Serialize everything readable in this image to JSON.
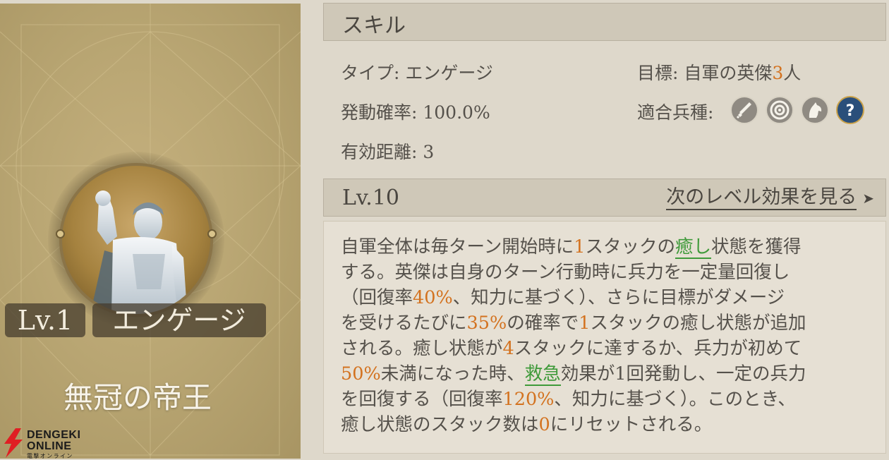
{
  "card": {
    "level": "Lv.1",
    "skill_type_badge": "エンゲージ",
    "skill_name": "無冠の帝王",
    "accent_color": "#b9a673"
  },
  "logo": {
    "line1": "DENGEKI",
    "line2": "ONLINE",
    "line3": "電撃オンライン"
  },
  "skill_section": {
    "title": "スキル",
    "type_label": "タイプ: エンゲージ",
    "trigger_rate_label": "発動確率: 100.0%",
    "range_label": "有効距離: 3",
    "target_prefix": "目標: 自軍の英傑",
    "target_count": "3",
    "target_suffix": "人",
    "troop_label": "適合兵種:",
    "troop_icons": [
      "sword-icon",
      "target-archery-icon",
      "horse-icon",
      "question-icon"
    ]
  },
  "level_section": {
    "level": "Lv.10",
    "next_link": "次のレベル効果を見る"
  },
  "description": {
    "l1": [
      "自軍全体は毎ターン開始時に",
      "1",
      "スタックの",
      "癒し",
      "状態を獲得"
    ],
    "l2": [
      "する。英傑は自身のターン行動時に兵力を一定量回復し"
    ],
    "l3": [
      "（回復率",
      "40%",
      "、知力に基づく）、さらに目標がダメージ"
    ],
    "l4": [
      "を受けるたびに",
      "35%",
      "の確率で",
      "1",
      "スタックの癒し状態が追加"
    ],
    "l5": [
      "される。癒し状態が",
      "4",
      "スタックに達するか、兵力が初めて"
    ],
    "l6": [
      "50%",
      "未満になった時、",
      "救急",
      "効果が1回発動し、一定の兵力"
    ],
    "l7": [
      "を回復する（回復率",
      "120%",
      "、知力に基づく）。このとき、"
    ],
    "l8": [
      "癒し状態のスタック数は",
      "0",
      "にリセットされる。"
    ]
  },
  "colors": {
    "highlight": "#d3721f",
    "keyword": "#3f9a3a"
  }
}
